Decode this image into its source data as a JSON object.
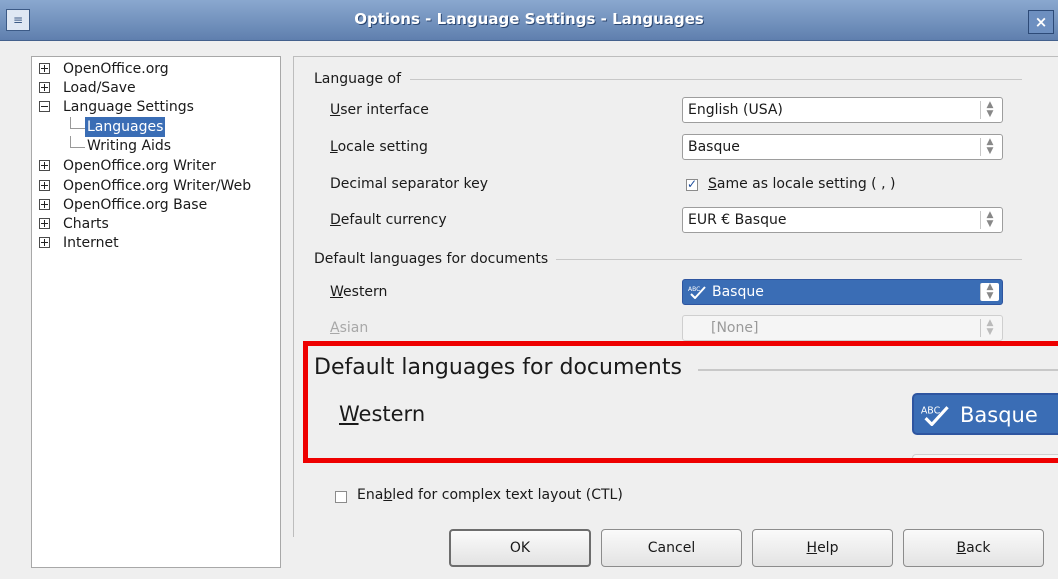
{
  "window": {
    "title": "Options - Language Settings - Languages",
    "close_glyph": "×",
    "app_icon_glyph": "≡"
  },
  "tree": {
    "items": [
      {
        "label": "OpenOffice.org",
        "expander": "plus"
      },
      {
        "label": "Load/Save",
        "expander": "plus"
      },
      {
        "label": "Language Settings",
        "expander": "minus"
      },
      {
        "label": "Languages",
        "selected": true
      },
      {
        "label": "Writing Aids"
      },
      {
        "label": "OpenOffice.org Writer",
        "expander": "plus"
      },
      {
        "label": "OpenOffice.org Writer/Web",
        "expander": "plus"
      },
      {
        "label": "OpenOffice.org Base",
        "expander": "plus"
      },
      {
        "label": "Charts",
        "expander": "plus"
      },
      {
        "label": "Internet",
        "expander": "plus"
      }
    ]
  },
  "language_of": {
    "section_title": "Language of",
    "user_interface": {
      "label_u": "U",
      "label_rest": "ser interface",
      "value": "English (USA)"
    },
    "locale_setting": {
      "label_u": "L",
      "label_rest": "ocale setting",
      "value": "Basque"
    },
    "decimal_separator": {
      "label": "Decimal separator key",
      "check_u": "S",
      "check_rest": "ame as locale setting ( , )",
      "checked": true
    },
    "default_currency": {
      "label_u": "D",
      "label_rest": "efault currency",
      "value": "EUR € Basque"
    }
  },
  "default_languages": {
    "section_title": "Default languages for documents",
    "western": {
      "label_u": "W",
      "label_rest": "estern",
      "value": "Basque"
    },
    "asian": {
      "label_u": "A",
      "label_rest": "sian",
      "value": "[None]"
    }
  },
  "ctl": {
    "label_pre": "Ena",
    "label_u": "b",
    "label_rest": "led for complex text layout (CTL)",
    "checked": false
  },
  "zoom_callout": {
    "section_title": "Default languages for documents",
    "label_u": "W",
    "label_rest": "estern",
    "value": "Basque",
    "highlight_color": "#ee0000"
  },
  "buttons": {
    "ok": "OK",
    "cancel": "Cancel",
    "help_u": "H",
    "help_rest": "elp",
    "back_u": "B",
    "back_rest": "ack"
  },
  "colors": {
    "selection": "#3a6db5",
    "title_bar": "#5f7fae"
  }
}
